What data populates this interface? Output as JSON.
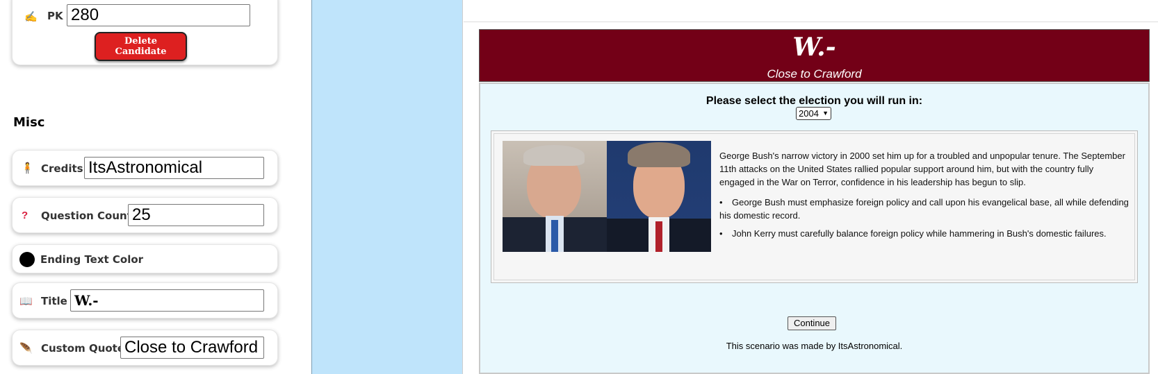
{
  "editor": {
    "pk": {
      "icon": "writing-hand-icon",
      "label": "PK",
      "value": "280"
    },
    "delete_button": "Delete Candidate",
    "misc_heading": "Misc",
    "fields": {
      "credits": {
        "icon": "person-icon",
        "label": "Credits",
        "value": "ItsAstronomical"
      },
      "question_count": {
        "icon": "question-mark-icon",
        "label": "Question Count",
        "value": "25"
      },
      "ending_text_color": {
        "label": "Ending Text Color",
        "color": "#000000"
      },
      "title": {
        "icon": "book-icon",
        "label": "Title",
        "value": "W.-"
      },
      "custom_quote": {
        "icon": "feather-icon",
        "label": "Custom Quote",
        "value": "Close to Crawford"
      }
    }
  },
  "preview": {
    "title": "W.-",
    "subtitle": "Close to Crawford",
    "prompt": "Please select the election you will run in:",
    "year_selected": "2004",
    "description": "George Bush's narrow victory in 2000 set him up for a troubled and unpopular tenure. The September 11th attacks on the United States rallied popular support around him, but with the country fully engaged in the War on Terror, confidence in his leadership has begun to slip.",
    "bullets": [
      "George Bush must emphasize foreign policy and call upon his evangelical base, all while defending his domestic record.",
      "John Kerry must carefully balance foreign policy while hammering in Bush's domestic failures."
    ],
    "continue_label": "Continue",
    "credit_text": "This scenario was made by ItsAstronomical."
  },
  "colors": {
    "header_bg": "#730017",
    "content_bg": "#e9f8fd",
    "strip_bg": "#bfe4fb",
    "delete_bg": "#dd2020"
  }
}
